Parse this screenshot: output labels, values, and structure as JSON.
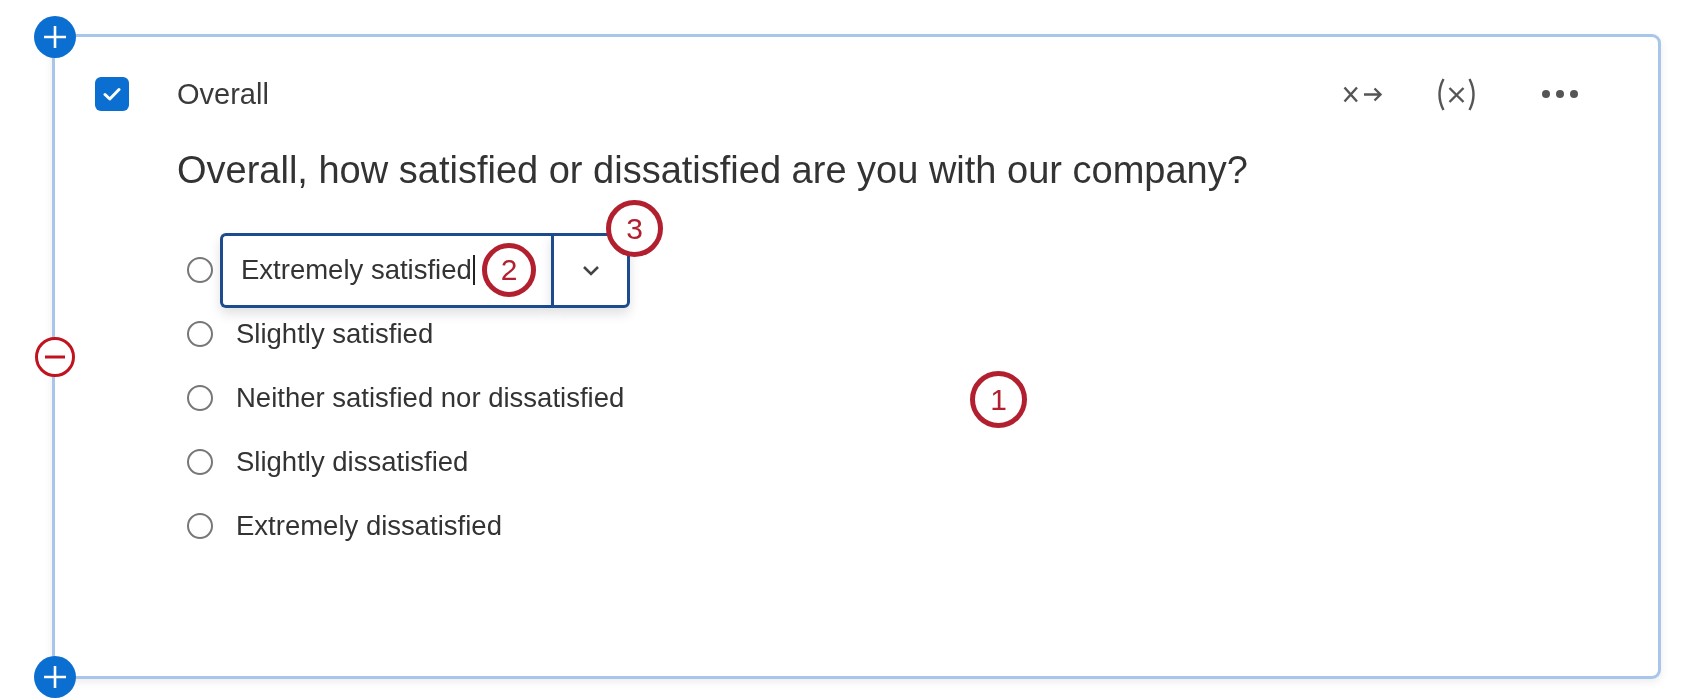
{
  "question": {
    "checked": true,
    "label": "Overall",
    "text": "Overall, how satisfied or dissatisfied are you with our company?"
  },
  "options": [
    {
      "label": "Extremely satisfied",
      "selected": false,
      "editing": true
    },
    {
      "label": "Slightly satisfied",
      "selected": false,
      "editing": false
    },
    {
      "label": "Neither satisfied nor dissatisfied",
      "selected": false,
      "editing": false
    },
    {
      "label": "Slightly dissatisfied",
      "selected": false,
      "editing": false
    },
    {
      "label": "Extremely dissatisfied",
      "selected": false,
      "editing": false
    }
  ],
  "callouts": [
    {
      "label": "1"
    },
    {
      "label": "2"
    },
    {
      "label": "3"
    }
  ]
}
